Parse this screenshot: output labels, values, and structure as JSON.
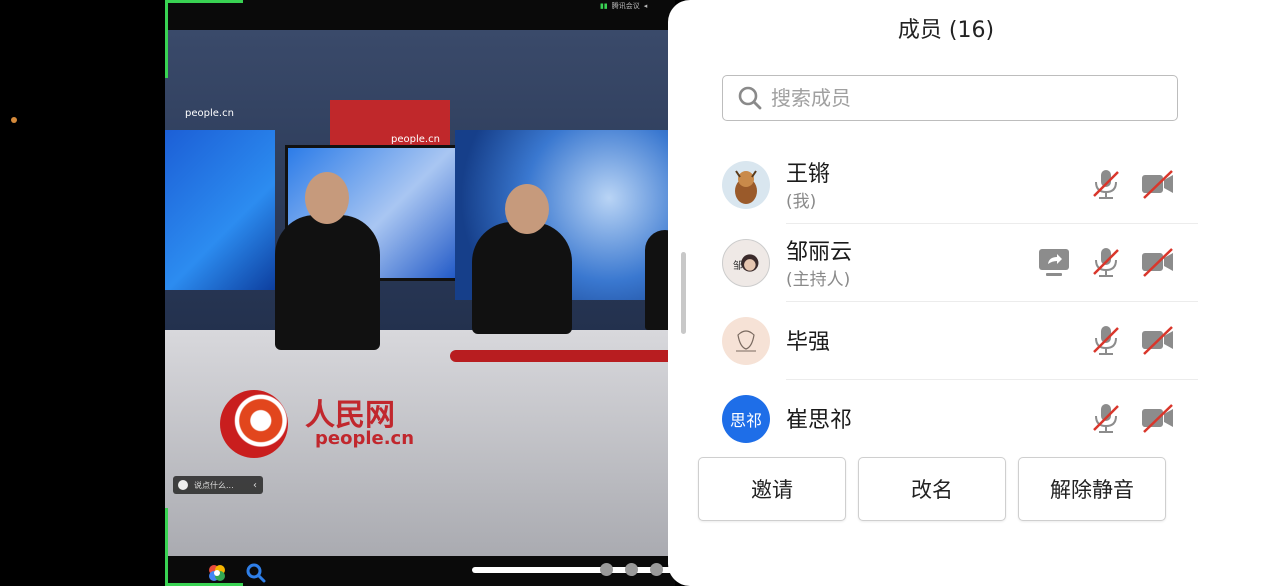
{
  "panel": {
    "title": "成员 (16)",
    "search": {
      "placeholder": "搜索成员"
    },
    "members": [
      {
        "name": "王锵",
        "role": "(我)",
        "avatar_text": ""
      },
      {
        "name": "邹丽云",
        "role": "(主持人)",
        "avatar_text": "邹",
        "sharing": true
      },
      {
        "name": "毕强",
        "role": "",
        "avatar_text": ""
      },
      {
        "name": "崔思祁",
        "role": "",
        "avatar_text": "思祁"
      }
    ],
    "buttons": {
      "invite": "邀请",
      "rename": "改名",
      "unmute_all": "解除静音"
    }
  },
  "video": {
    "chat_placeholder": "说点什么...",
    "logo_text": "人民网",
    "logo_url": "people.cn",
    "small_logo": "people.cn",
    "status_app": "腾讯会议"
  },
  "colors": {
    "accent_blue": "#1e6ee8",
    "muted_red": "#d9362b",
    "frame_green": "#39d353"
  },
  "icons": [
    "search-icon",
    "mic-muted-icon",
    "camera-off-icon",
    "screen-share-icon"
  ]
}
